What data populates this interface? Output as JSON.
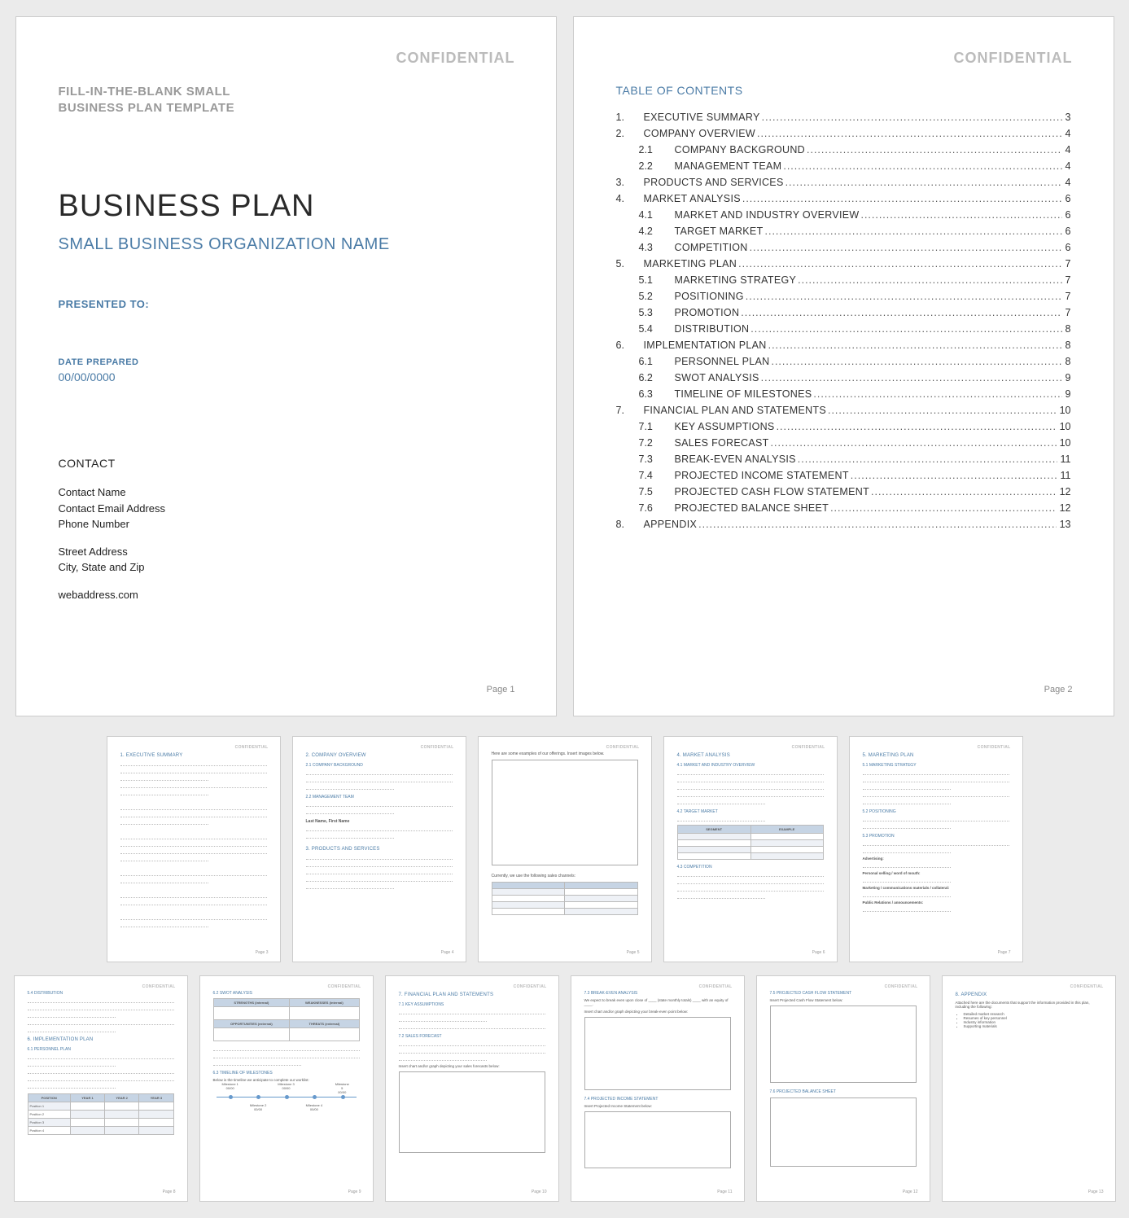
{
  "confidential_label": "CONFIDENTIAL",
  "page1": {
    "template_label_line1": "FILL-IN-THE-BLANK SMALL",
    "template_label_line2": "BUSINESS PLAN TEMPLATE",
    "title": "BUSINESS PLAN",
    "org_name": "SMALL BUSINESS ORGANIZATION NAME",
    "presented_to_label": "PRESENTED TO:",
    "date_prepared_label": "DATE PREPARED",
    "date_prepared_value": "00/00/0000",
    "contact_heading": "CONTACT",
    "contact_name": "Contact Name",
    "contact_email": "Contact Email Address",
    "contact_phone": "Phone Number",
    "contact_street": "Street Address",
    "contact_city": "City, State and Zip",
    "contact_web": "webaddress.com",
    "page_number": "Page 1"
  },
  "page2": {
    "toc_heading": "TABLE OF CONTENTS",
    "items": [
      {
        "num": "1.",
        "label": "EXECUTIVE SUMMARY",
        "page": "3",
        "level": 0
      },
      {
        "num": "2.",
        "label": "COMPANY OVERVIEW",
        "page": "4",
        "level": 0
      },
      {
        "num": "2.1",
        "label": "COMPANY BACKGROUND",
        "page": "4",
        "level": 1
      },
      {
        "num": "2.2",
        "label": "MANAGEMENT TEAM",
        "page": "4",
        "level": 1
      },
      {
        "num": "3.",
        "label": "PRODUCTS AND SERVICES",
        "page": "4",
        "level": 0
      },
      {
        "num": "4.",
        "label": "MARKET ANALYSIS",
        "page": "6",
        "level": 0
      },
      {
        "num": "4.1",
        "label": "MARKET AND INDUSTRY OVERVIEW",
        "page": "6",
        "level": 1
      },
      {
        "num": "4.2",
        "label": "TARGET MARKET",
        "page": "6",
        "level": 1
      },
      {
        "num": "4.3",
        "label": "COMPETITION",
        "page": "6",
        "level": 1
      },
      {
        "num": "5.",
        "label": "MARKETING PLAN",
        "page": "7",
        "level": 0
      },
      {
        "num": "5.1",
        "label": "MARKETING STRATEGY",
        "page": "7",
        "level": 1
      },
      {
        "num": "5.2",
        "label": "POSITIONING",
        "page": "7",
        "level": 1
      },
      {
        "num": "5.3",
        "label": "PROMOTION",
        "page": "7",
        "level": 1
      },
      {
        "num": "5.4",
        "label": "DISTRIBUTION",
        "page": "8",
        "level": 1
      },
      {
        "num": "6.",
        "label": "IMPLEMENTATION PLAN",
        "page": "8",
        "level": 0
      },
      {
        "num": "6.1",
        "label": "PERSONNEL PLAN",
        "page": "8",
        "level": 1
      },
      {
        "num": "6.2",
        "label": "SWOT ANALYSIS",
        "page": "9",
        "level": 1
      },
      {
        "num": "6.3",
        "label": "TIMELINE OF MILESTONES",
        "page": "9",
        "level": 1
      },
      {
        "num": "7.",
        "label": "FINANCIAL PLAN AND STATEMENTS",
        "page": "10",
        "level": 0
      },
      {
        "num": "7.1",
        "label": "KEY ASSUMPTIONS",
        "page": "10",
        "level": 1
      },
      {
        "num": "7.2",
        "label": "SALES FORECAST",
        "page": "10",
        "level": 1
      },
      {
        "num": "7.3",
        "label": "BREAK-EVEN ANALYSIS",
        "page": "11",
        "level": 1
      },
      {
        "num": "7.4",
        "label": "PROJECTED INCOME STATEMENT",
        "page": "11",
        "level": 1
      },
      {
        "num": "7.5",
        "label": "PROJECTED CASH FLOW STATEMENT",
        "page": "12",
        "level": 1
      },
      {
        "num": "7.6",
        "label": "PROJECTED BALANCE SHEET",
        "page": "12",
        "level": 1
      },
      {
        "num": "8.",
        "label": "APPENDIX",
        "page": "13",
        "level": 0
      }
    ],
    "page_number": "Page 2"
  },
  "thumbs": {
    "p3": {
      "title": "1.  EXECUTIVE SUMMARY",
      "pn": "Page 3"
    },
    "p4": {
      "title": "2.  COMPANY OVERVIEW",
      "s1": "2.1  COMPANY BACKGROUND",
      "s2": "2.2  MANAGEMENT TEAM",
      "s3": "3.  PRODUCTS AND SERVICES",
      "name_label": "Last Name, First Name",
      "pn": "Page 4"
    },
    "p5": {
      "line1": "Here are some examples of our offerings. Insert images below.",
      "line2": "Currently, we use the following sales channels:",
      "pn": "Page 5"
    },
    "p6": {
      "title": "4.  MARKET ANALYSIS",
      "s1": "4.1  MARKET AND INDUSTRY OVERVIEW",
      "s2": "4.2  TARGET MARKET",
      "s3": "4.3  COMPETITION",
      "th_segment": "SEGMENT",
      "th_example": "EXAMPLE",
      "pn": "Page 6"
    },
    "p7": {
      "title": "5.  MARKETING PLAN",
      "s1": "5.1  MARKETING STRATEGY",
      "s2": "5.2  POSITIONING",
      "s3": "5.3  PROMOTION",
      "adv": "Advertising:",
      "ps": "Personal selling / word of mouth:",
      "mc": "Marketing / communications materials / collateral:",
      "pr": "Public Relations / announcements:",
      "pn": "Page 7"
    },
    "p8": {
      "s1": "5.4  DISTRIBUTION",
      "title": "6.  IMPLEMENTATION PLAN",
      "s2": "6.1  PERSONNEL PLAN",
      "th_pos": "POSITION",
      "th_y1": "YEAR 1",
      "th_y2": "YEAR 2",
      "th_y3": "YEAR 3",
      "r1": "Position 1",
      "r2": "Position 2",
      "r3": "Position 3",
      "r4": "Position 4",
      "pn": "Page 8"
    },
    "p9": {
      "s1": "6.2  SWOT ANALYSIS",
      "th_si": "STRENGTHS (internal)",
      "th_wi": "WEAKNESSES (internal)",
      "th_oe": "OPPORTUNITIES (external)",
      "th_te": "THREATS (external)",
      "s2": "6.3  TIMELINE OF MILESTONES",
      "tl_intro": "Below is the timeline we anticipate to complete our worklist:",
      "m1a": "Milestone 1",
      "m1b": "00/00",
      "m2a": "Milestone 2",
      "m2b": "00/00",
      "m3a": "Milestone 3",
      "m3b": "00/00",
      "m4a": "Milestone 4",
      "m4b": "00/00",
      "m5a": "Milestone 5",
      "m5b": "00/00",
      "pn": "Page 9"
    },
    "p10": {
      "title": "7.  FINANCIAL PLAN AND STATEMENTS",
      "s1": "7.1  KEY ASSUMPTIONS",
      "s2": "7.2  SALES FORECAST",
      "note": "Insert chart and/or graph depicting your sales forecasts below:",
      "pn": "Page 10"
    },
    "p11": {
      "s1": "7.3  BREAK-EVEN ANALYSIS",
      "line1": "We expect to break even upon close of ____ (state monthly totals) ____ with an equity of ____.",
      "note": "Insert chart and/or graph depicting your break-even point below:",
      "s2": "7.4  PROJECTED INCOME STATEMENT",
      "note2": "Insert Projected Income Statement below:",
      "pn": "Page 11"
    },
    "p12": {
      "s1": "7.5  PROJECTED CASH FLOW STATEMENT",
      "note1": "Insert Projected Cash Flow Statement below:",
      "s2": "7.6  PROJECTED BALANCE SHEET",
      "pn": "Page 12"
    },
    "p13": {
      "title": "8.  APPENDIX",
      "intro": "Attached here are the documents that support the information provided in this plan, including the following:",
      "b1": "Detailed market research",
      "b2": "Resumes of key personnel",
      "b3": "Industry information",
      "b4": "Supporting materials",
      "pn": "Page 13"
    }
  }
}
